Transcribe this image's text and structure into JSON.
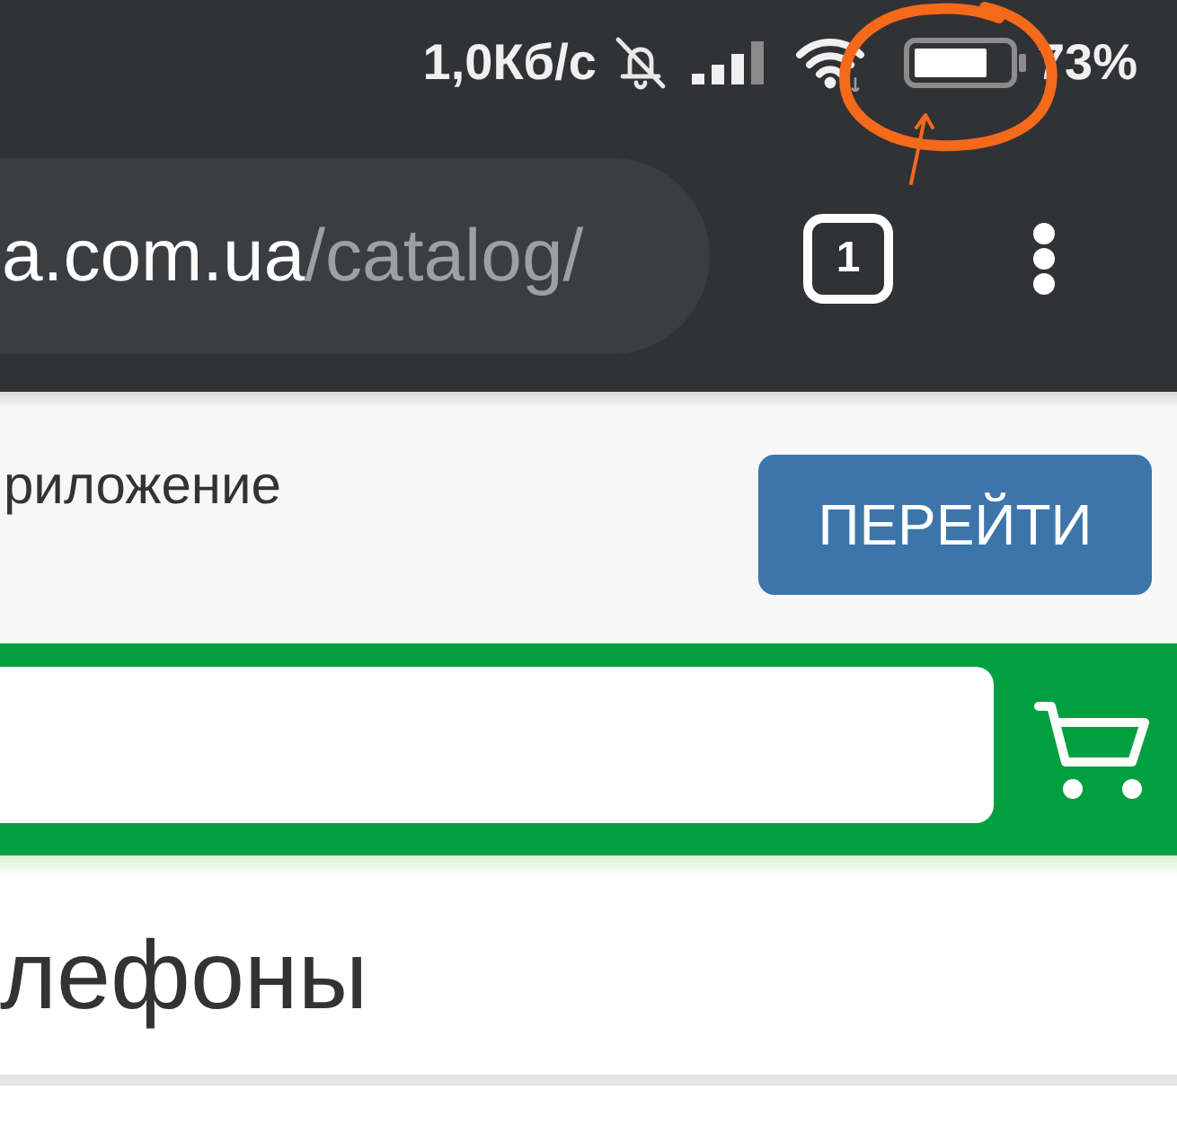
{
  "status_bar": {
    "network_speed": "1,0Кб/с",
    "battery": "73%"
  },
  "browser_toolbar": {
    "url": {
      "host": "a.com.ua",
      "path": "/catalog/"
    },
    "tab_count": "1"
  },
  "app_banner": {
    "text": "риложение",
    "button": "ПЕРЕЙТИ"
  },
  "page_title": "лефоны",
  "annotation": {
    "kind": "circle_with_arrow"
  }
}
